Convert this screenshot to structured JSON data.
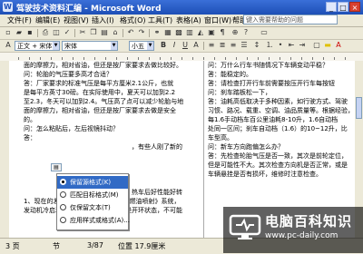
{
  "window": {
    "title": "驾驶技术资料汇编 - Microsoft Word",
    "minimize": "_",
    "maximize": "□",
    "close": "×"
  },
  "menubar": {
    "items": [
      "文件(F)",
      "编辑(E)",
      "视图(V)",
      "插入(I)",
      "格式(O)",
      "工具(T)",
      "表格(A)",
      "窗口(W)",
      "帮助(H)"
    ],
    "help_placeholder": "键入需要帮助的问题"
  },
  "toolbar": {
    "style_value": "正文 + 宋体",
    "font_value": "宋体",
    "size_value": "小五",
    "buttons": [
      "B",
      "I",
      "U",
      "A"
    ]
  },
  "document": {
    "left_column": [
      "面的摩擦力，相对省油，但还是按厂家要求去做比较好。",
      "问：轮胎的气压要多高才合适？",
      "答：厂家要求的标准气压是每平方厘米2.1公斤，也就",
      "是每平方英寸30磅。在实际使用中，夏天可以加到2.2",
      "至2.3，冬天可以加到2.4。气压高了点可以减少轮胎与地",
      "面的摩擦力，相对省油，但还是按厂家要求去做是安全",
      "的。",
      "问：怎么粘贴后，左后视镜抖动？",
      "答：",
      "",
      "",
      "",
      "",
      "",
      "",
      "1、现在的发动机都是电喷《电子控制燃油喷射》系统，",
      "发动机冷启动并好高转速，冷车启动是开环状态，不可能"
    ],
    "right_column": [
      "问：万什么行车书随情况下车辆变动平稳？",
      "答：能稳定的。",
      "答：请检查打开行车前需要按压开行车每按钮",
      "问：刹车踏板松一下，",
      "答：油耗高低取决于多种因素，如行驶方式、驾驶",
      "习惯、路况、载重、空调、油品质量等。根据经验，",
      "每1.6手动档车百公里油耗8-10升，1.6自动档",
      "处同一区间；刹车自动档（1.6）的10~12升，比",
      "车型高。",
      "问：新车方向跑偏怎么办？",
      "答：先检查轮胎气压是否一致，其次是前轮定位，",
      "但是可能性不大。其次检查方向机是否正常，或是",
      "车辆悬挂是否有损坏，维修时注意检查。",
      "",
      "",
      "",
      ""
    ],
    "partial_line": "，有些人刚了新的",
    "partial_line2": "热车后好性能好转"
  },
  "paste_menu": {
    "items": [
      {
        "label": "保留源格式(K)",
        "checked": true,
        "highlighted": true
      },
      {
        "label": "匹配目标格式(M)",
        "checked": false,
        "highlighted": false
      },
      {
        "label": "仅保留文本(T)",
        "checked": false,
        "highlighted": false
      },
      {
        "label": "应用样式或格式(A)...",
        "checked": false,
        "highlighted": false
      }
    ]
  },
  "status_bar": {
    "page": "3 页",
    "section": "节",
    "page_count": "3/87",
    "position": "位置 17.9厘米"
  },
  "watermark": {
    "title": "电脑百科知识",
    "url": "www.pc-daily.com"
  }
}
